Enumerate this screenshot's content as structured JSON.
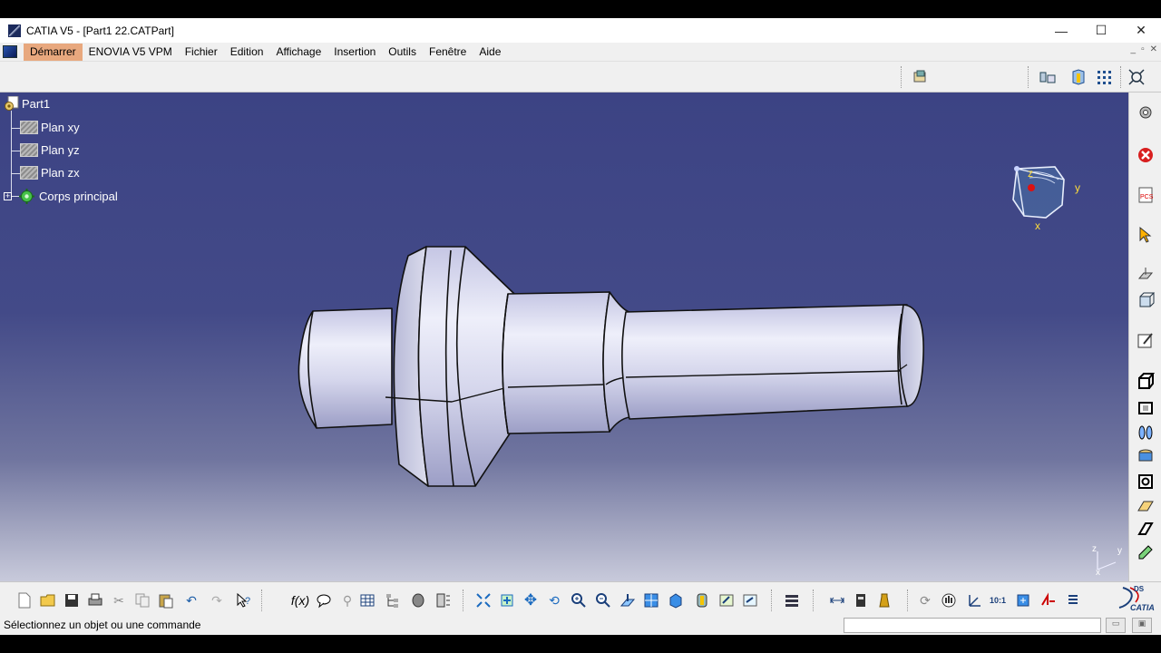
{
  "window": {
    "title": "CATIA V5 - [Part1 22.CATPart]",
    "minimize": "—",
    "maximize": "☐",
    "close": "✕"
  },
  "menu": {
    "items": [
      "Démarrer",
      "ENOVIA V5 VPM",
      "Fichier",
      "Edition",
      "Affichage",
      "Insertion",
      "Outils",
      "Fenêtre",
      "Aide"
    ],
    "mdi": [
      "_",
      "▫",
      "✕"
    ]
  },
  "tree": {
    "root": "Part1",
    "children": [
      "Plan xy",
      "Plan yz",
      "Plan zx",
      "Corps principal"
    ]
  },
  "compass": {
    "x": "x",
    "y": "y",
    "z": "z"
  },
  "mini_axis": {
    "x": "x",
    "y": "y",
    "z": "z"
  },
  "status": {
    "message": "Sélectionnez un objet ou une commande",
    "command_value": ""
  },
  "branding": {
    "catia_label": "CATIA",
    "ds_label": "DS"
  },
  "colors": {
    "viewport_top": "#3c4384",
    "viewport_bottom": "#c8cadb",
    "part_fill": "#d8d9ec",
    "active_menu": "#e8a87e",
    "tree_text": "#ffffff"
  },
  "icons": {
    "right_toolbar": [
      "gear-icon",
      "stop-icon",
      "pcs-icon",
      "select-icon",
      "plane-icon",
      "cube-icon",
      "sketch-icon",
      "pad-icon",
      "pocket-icon",
      "shaft-icon",
      "groove-icon",
      "hole-icon",
      "rib-icon",
      "slot-icon",
      "edit-icon"
    ],
    "bottom_toolbar": [
      "new-icon",
      "open-icon",
      "save-icon",
      "print-icon",
      "cut-icon",
      "copy-icon",
      "paste-icon",
      "undo-icon",
      "redo-icon",
      "whats-this-icon",
      "formula-icon",
      "comment-icon",
      "link-icon",
      "table-icon",
      "tree-icon",
      "measure-icon",
      "analysis-icon",
      "fit-all-icon",
      "select-icon",
      "pan-icon",
      "rotate-icon",
      "zoom-in-icon",
      "zoom-out-icon",
      "normal-view-icon",
      "multi-view-icon",
      "iso-view-icon",
      "shading-icon",
      "hide-show-icon",
      "swap-icon",
      "render-icon",
      "workbench-icon",
      "measure-between-icon",
      "inertia-icon",
      "material-icon",
      "update-icon",
      "hand-icon",
      "axis-icon",
      "scale-icon",
      "zoom-area-icon",
      "constraint-icon",
      "list-icon"
    ]
  }
}
